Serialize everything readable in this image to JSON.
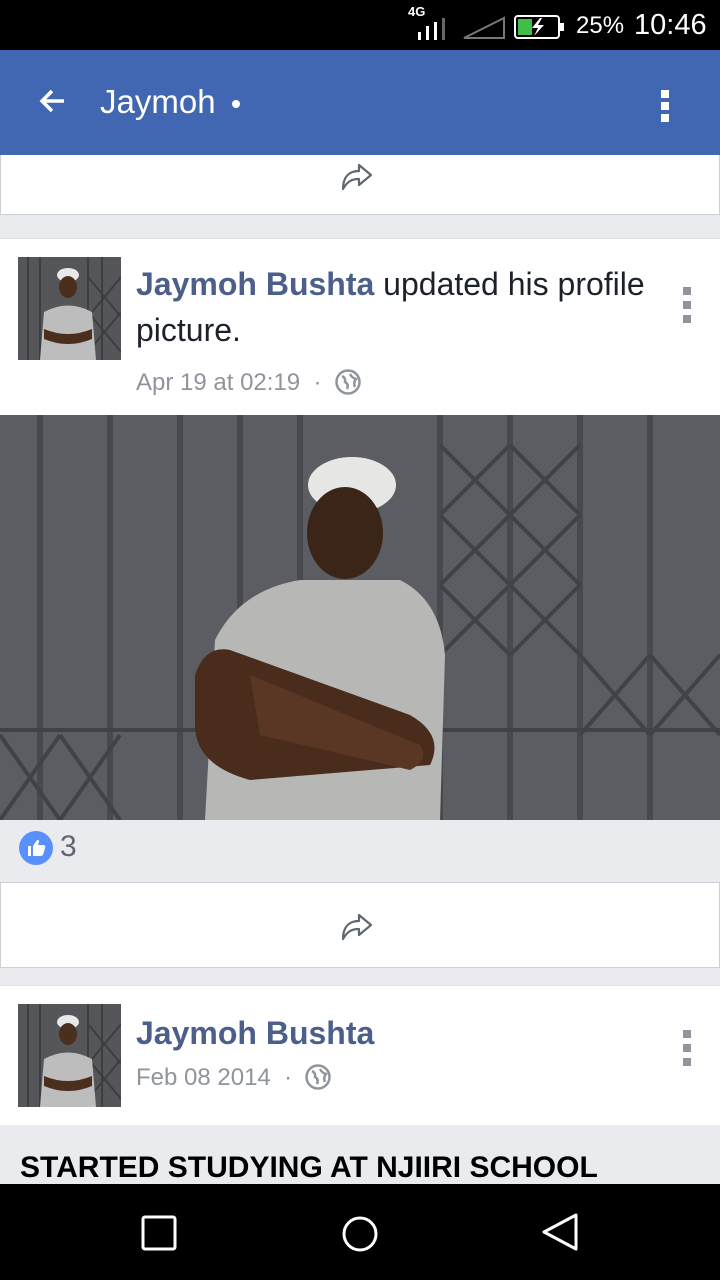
{
  "status_bar": {
    "network": "4G",
    "battery_percent": "25%",
    "time": "10:46"
  },
  "app_bar": {
    "title": "Jaymoh",
    "back_icon": "arrow-left-icon",
    "menu_icon": "more-vertical-icon"
  },
  "posts": [
    {
      "author": "Jaymoh Bushta",
      "action": " updated his profile picture.",
      "date": "Apr 19 at 02:19",
      "separator": "·",
      "privacy_icon": "globe-icon",
      "likes_count": "3"
    },
    {
      "author": "Jaymoh Bushta",
      "date": "Feb 08 2014",
      "separator": "·",
      "privacy_icon": "globe-icon",
      "text": "STARTED STUDYING AT NJIIRI SCHOOL"
    }
  ],
  "colors": {
    "brand": "#4267b2",
    "name": "#4b5f8a",
    "meta": "#90949c",
    "background": "#e9ebee"
  }
}
